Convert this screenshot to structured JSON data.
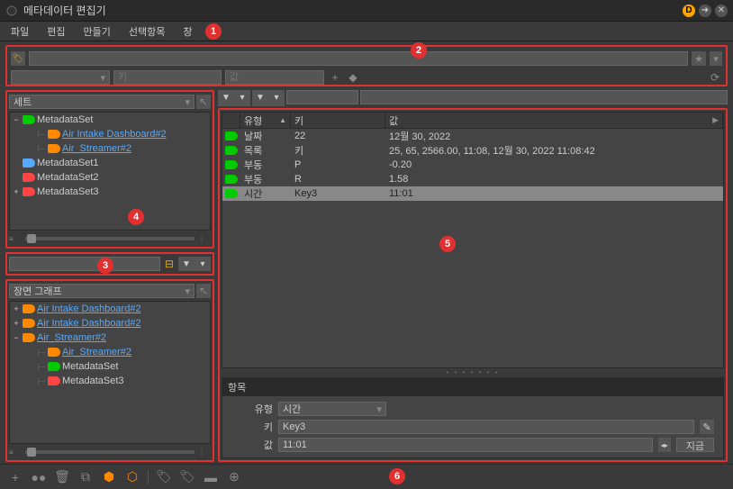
{
  "window": {
    "title": "메타데이터 편집기"
  },
  "titlebar": {
    "d": "D"
  },
  "menu": {
    "file": "파일",
    "edit": "편집",
    "create": "만들기",
    "selection": "선택항목",
    "window": "창"
  },
  "badges": {
    "b1": "1",
    "b2": "2",
    "b3": "3",
    "b4": "4",
    "b5": "5",
    "b6": "6"
  },
  "topbar": {
    "combo": "",
    "key_ph": "키",
    "val_ph": "값"
  },
  "sets_panel": {
    "label": "세트",
    "items": [
      {
        "label": "MetadataSet",
        "color": "green",
        "plain": true,
        "exp": "−",
        "indent": 0
      },
      {
        "label": "Air Intake Dashboard#2",
        "color": "orange",
        "plain": false,
        "exp": "",
        "indent": 1
      },
      {
        "label": "Air_Streamer#2",
        "color": "orange",
        "plain": false,
        "exp": "",
        "indent": 1
      },
      {
        "label": "MetadataSet1",
        "color": "blue",
        "plain": true,
        "exp": "",
        "indent": 0
      },
      {
        "label": "MetadataSet2",
        "color": "red",
        "plain": true,
        "exp": "",
        "indent": 0
      },
      {
        "label": "MetadataSet3",
        "color": "red",
        "plain": true,
        "exp": "+",
        "indent": 0
      }
    ]
  },
  "scene_panel": {
    "label": "장면 그래프",
    "items": [
      {
        "label": "Air Intake Dashboard#2",
        "color": "orange",
        "plain": false,
        "exp": "+",
        "indent": 0
      },
      {
        "label": "Air Intake Dashboard#2",
        "color": "orange",
        "plain": false,
        "exp": "+",
        "indent": 0
      },
      {
        "label": "Air_Streamer#2",
        "color": "orange",
        "plain": false,
        "exp": "−",
        "indent": 0
      },
      {
        "label": "Air_Streamer#2",
        "color": "orange",
        "plain": false,
        "exp": "",
        "indent": 1
      },
      {
        "label": "MetadataSet",
        "color": "green",
        "plain": true,
        "exp": "",
        "indent": 1
      },
      {
        "label": "MetadataSet3",
        "color": "red",
        "plain": true,
        "exp": "",
        "indent": 1
      }
    ]
  },
  "table": {
    "headers": {
      "type": "유형",
      "key": "키",
      "val": "값"
    },
    "rows": [
      {
        "type": "날짜",
        "key": "22",
        "val": "12월 30, 2022",
        "selected": false
      },
      {
        "type": "목록",
        "key": "키",
        "val": "25, 65, 2566.00, 11:08, 12월 30, 2022 11:08:42",
        "selected": false
      },
      {
        "type": "부동",
        "key": "P",
        "val": "-0.20",
        "selected": false
      },
      {
        "type": "부동",
        "key": "R",
        "val": "1.58",
        "selected": false
      },
      {
        "type": "시간",
        "key": "Key3",
        "val": "11:01",
        "selected": true
      }
    ]
  },
  "detail": {
    "header": "항목",
    "type_label": "유형",
    "type_val": "시간",
    "key_label": "키",
    "key_val": "Key3",
    "val_label": "값",
    "val_val": "11:01",
    "now_btn": "지금"
  }
}
